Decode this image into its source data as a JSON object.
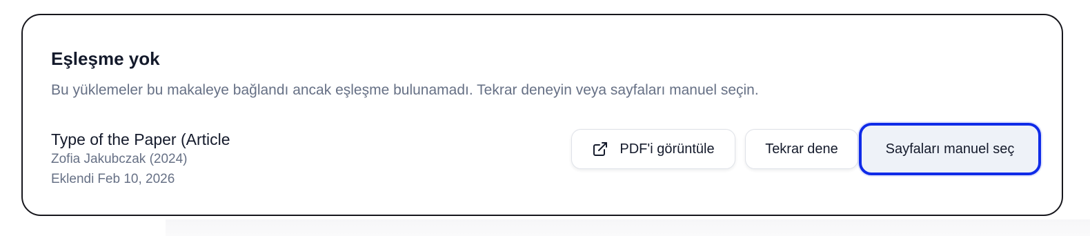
{
  "card": {
    "title": "Eşleşme yok",
    "description": "Bu yüklemeler bu makaleye bağlandı ancak eşleşme bulunamadı. Tekrar deneyin veya sayfaları manuel seçin."
  },
  "paper": {
    "title": "Type of the Paper (Article",
    "authors": "Zofia Jakubczak (2024)",
    "added_label": "Eklendi",
    "added_date": "Feb 10, 2026"
  },
  "actions": {
    "view_pdf_label": "PDF'i görüntüle",
    "view_pdf_icon": "external-link-icon",
    "retry_label": "Tekrar dene",
    "manual_label": "Sayfaları manuel seç"
  },
  "colors": {
    "focus_ring": "#0f2be8",
    "title_text": "#141a2b",
    "muted_text": "#667085",
    "card_border": "#16161c"
  }
}
